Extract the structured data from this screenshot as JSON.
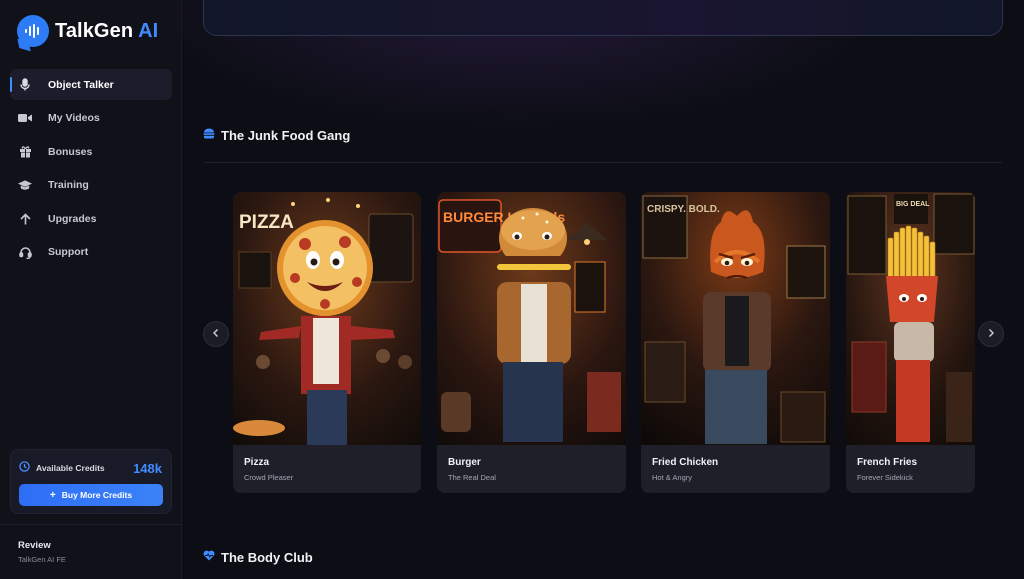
{
  "app": {
    "name": "TalkGen",
    "name_suffix": "AI"
  },
  "sidebar": {
    "items": [
      {
        "label": "Object Talker",
        "icon": "microphone-icon",
        "active": true
      },
      {
        "label": "My Videos",
        "icon": "video-camera-icon",
        "active": false
      },
      {
        "label": "Bonuses",
        "icon": "gift-icon",
        "active": false
      },
      {
        "label": "Training",
        "icon": "graduation-cap-icon",
        "active": false
      },
      {
        "label": "Upgrades",
        "icon": "arrow-up-icon",
        "active": false
      },
      {
        "label": "Support",
        "icon": "headset-icon",
        "active": false
      }
    ],
    "credits": {
      "label": "Available Credits",
      "value": "148k",
      "button_label": "Buy More Credits"
    },
    "review": {
      "title": "Review",
      "subtitle": "TalkGen AI FE"
    }
  },
  "main": {
    "sections": [
      {
        "title": "The Junk Food Gang",
        "icon": "burger-icon",
        "cards": [
          {
            "name": "Pizza",
            "subtitle": "Crowd Pleaser",
            "sign": "PIZZA"
          },
          {
            "name": "Burger",
            "subtitle": "The Real Deal",
            "sign": "BURGER Legends"
          },
          {
            "name": "Fried Chicken",
            "subtitle": "Hot & Angry",
            "sign": "CRISPY. BOLD."
          },
          {
            "name": "French Fries",
            "subtitle": "Forever Sidekick",
            "sign": "BIG DEAL"
          }
        ]
      },
      {
        "title": "The Body Club",
        "icon": "heart-icon"
      }
    ]
  },
  "colors": {
    "accent": "#3f8bff",
    "background": "#0d0e15",
    "sidebar": "#101119",
    "card": "#1e1f28"
  }
}
